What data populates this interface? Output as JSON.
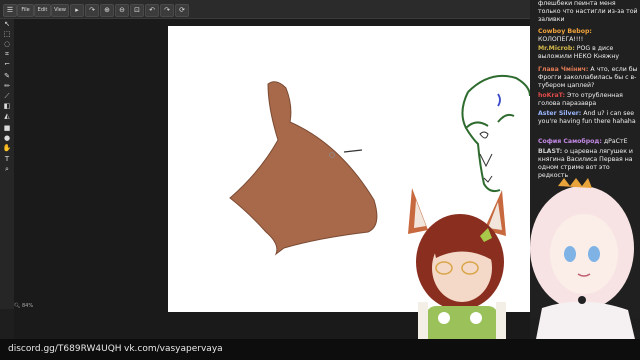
{
  "menu": {
    "file": "File",
    "edit": "Edit",
    "view": "View"
  },
  "toolbar_icons": [
    "arrow-icon",
    "marquee-icon",
    "lasso-icon",
    "crop-icon",
    "crop-alt-icon",
    "eyedropper-icon",
    "pencil-icon",
    "brush-icon",
    "eraser-icon",
    "fill-icon",
    "shape-icon",
    "circle-icon",
    "hand-icon",
    "text-icon",
    "zoom-icon"
  ],
  "status": {
    "zoom": "84%"
  },
  "chat": [
    {
      "user": "",
      "text": "флешбеки пеинта меня только что настигли из-за той заливки",
      "color": "#ffffff"
    },
    {
      "user": "Cowboy Bebop:",
      "text": "КОЛОПЕГА!!!!",
      "color": "#f2a33a"
    },
    {
      "user": "Mr.Microb:",
      "text": "РОG в дисе выложили НЕКО Княжну",
      "color": "#d4b84a"
    },
    {
      "user": "Глава Чмі́нич:",
      "text": "А что, если бы Фрогги заколлабилась бы с в-тубером цаплей?",
      "color": "#e07a55"
    },
    {
      "user": "hoKraT:",
      "text": "Это отрубленная голова паразавра",
      "color": "#e04a4a"
    },
    {
      "user": "Aster Silver:",
      "text": "And u? i can see you're having fun there hahaha",
      "color": "#9ab6ff"
    },
    {
      "user": "София Самоброд:",
      "text": "дРаСтЕ",
      "color": "#c48ae6"
    },
    {
      "user": "BLAST:",
      "text": "о царевна лягушек и княгина Василиса Первая на одном стриме вот это редкость",
      "color": "#cfcfcf"
    }
  ],
  "footer": {
    "discord": "discord.gg/T689RW4UQH",
    "vk": "vk.com/vasyapervaya"
  },
  "colors": {
    "brown_fill": "#a8694a",
    "sketch_green": "#2e6b2e"
  }
}
